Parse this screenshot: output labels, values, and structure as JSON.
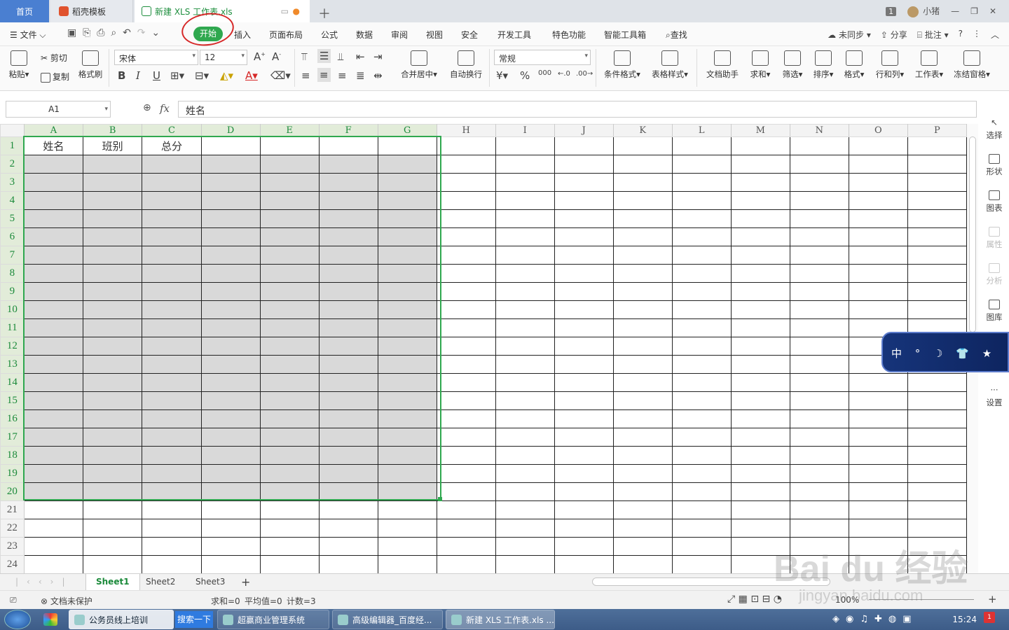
{
  "title_tabs": {
    "home": "首页",
    "template": "稻壳模板",
    "document": "新建 XLS 工作表.xls",
    "badge": "1",
    "user": "小猪"
  },
  "menu": {
    "file": "文件",
    "items": [
      "开始",
      "插入",
      "页面布局",
      "公式",
      "数据",
      "审阅",
      "视图",
      "安全",
      "开发工具",
      "特色功能",
      "智能工具箱"
    ],
    "search": "查找",
    "sync": "未同步",
    "share": "分享",
    "comment": "批注",
    "help": "?"
  },
  "ribbon": {
    "paste": "粘贴",
    "cut": "剪切",
    "copy": "复制",
    "format_painter": "格式刷",
    "font_name": "宋体",
    "font_size": "12",
    "merge_center": "合并居中",
    "wrap": "自动换行",
    "number_format": "常规",
    "percent": "%",
    "thousand": "000",
    "cond_format": "条件格式",
    "table_style": "表格样式",
    "doc_helper": "文档助手",
    "sum": "求和",
    "filter": "筛选",
    "sort": "排序",
    "format": "格式",
    "row_col": "行和列",
    "worksheet": "工作表",
    "freeze": "冻结窗格"
  },
  "formula_bar": {
    "name_box": "A1",
    "fx": "fx",
    "content": "姓名"
  },
  "columns": [
    "A",
    "B",
    "C",
    "D",
    "E",
    "F",
    "G",
    "H",
    "I",
    "J",
    "K",
    "L",
    "M",
    "N",
    "O",
    "P"
  ],
  "rows": [
    "1",
    "2",
    "3",
    "4",
    "5",
    "6",
    "7",
    "8",
    "9",
    "10",
    "11",
    "12",
    "13",
    "14",
    "15",
    "16",
    "17",
    "18",
    "19",
    "20",
    "21",
    "22",
    "23",
    "24"
  ],
  "cells": {
    "A1": "姓名",
    "B1": "班别",
    "C1": "总分"
  },
  "sidebar": [
    "选择",
    "形状",
    "图表",
    "属性",
    "分析",
    "图库",
    "设置"
  ],
  "ime": "中 ° ☽ 👕 ★",
  "sheets": [
    "Sheet1",
    "Sheet2",
    "Sheet3"
  ],
  "status": {
    "protect": "文档未保护",
    "sum": "求和=0",
    "avg": "平均值=0",
    "count": "计数=3",
    "zoom": "100%"
  },
  "taskbar": {
    "items": [
      "公务员线上培训",
      "搜索一下",
      "超赢商业管理系统",
      "高级编辑器_百度经...",
      "新建 XLS 工作表.xls ..."
    ],
    "clock": "15:24",
    "notif": "1"
  },
  "watermark": "Bai du 经验",
  "watermark_url": "jingyan.baidu.com"
}
